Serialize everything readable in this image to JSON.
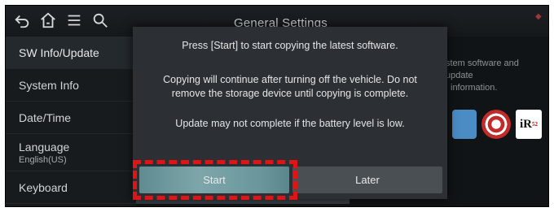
{
  "header": {
    "title": "General Settings",
    "icons": [
      "back-icon",
      "home-icon",
      "menu-icon",
      "search-icon"
    ]
  },
  "sidebar": {
    "items": [
      {
        "label": "SW Info/Update",
        "sub": ""
      },
      {
        "label": "System Info",
        "sub": ""
      },
      {
        "label": "Date/Time",
        "sub": ""
      },
      {
        "label": "Language",
        "sub": "English(US)"
      },
      {
        "label": "Keyboard",
        "sub": ""
      }
    ]
  },
  "background": {
    "description_line1": "stem software and update",
    "description_line2": "information."
  },
  "dialog": {
    "line1": "Press [Start] to start copying the latest software.",
    "line2": "Copying will continue after turning off the vehicle. Do not",
    "line3": "remove the storage device until copying is complete.",
    "line4": "Update may not complete if the battery level is low.",
    "start_label": "Start",
    "later_label": "Later"
  },
  "colors": {
    "highlight": "#e01414",
    "start_button": "#7ea6aa",
    "dialog_bg": "#2c3034"
  }
}
